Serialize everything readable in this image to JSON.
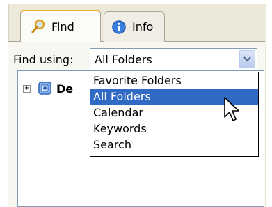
{
  "tabs": [
    {
      "label": "Find",
      "icon": "magnifier-icon",
      "active": true
    },
    {
      "label": "Info",
      "icon": "info-icon",
      "active": false
    }
  ],
  "find_using": {
    "label": "Find using:",
    "selected": "All Folders"
  },
  "dropdown": {
    "options": [
      "Favorite Folders",
      "All Folders",
      "Calendar",
      "Keywords",
      "Search"
    ],
    "highlighted": "All Folders"
  },
  "tree": {
    "nodes": [
      {
        "label": "De",
        "expander": "+",
        "icon": "desktop-icon"
      }
    ]
  },
  "colors": {
    "panel_bg": "#ece9d8",
    "selection": "#316ac5",
    "active_tab_accent": "#f0b33a"
  }
}
